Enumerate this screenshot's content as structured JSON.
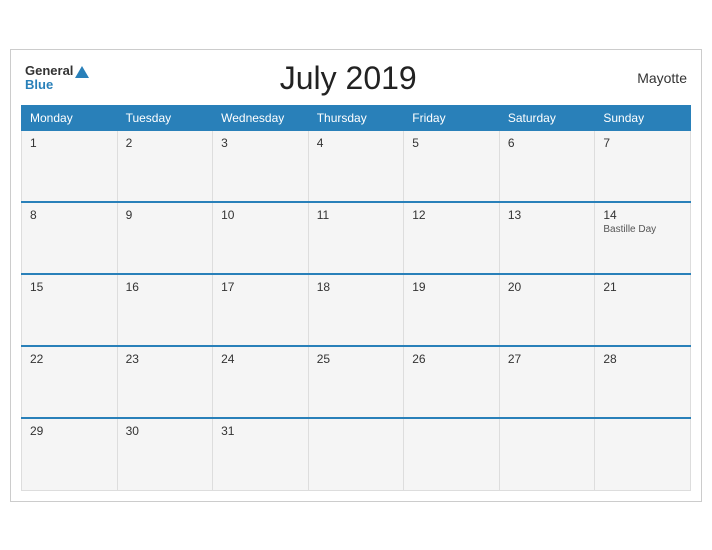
{
  "header": {
    "title": "July 2019",
    "region": "Mayotte",
    "logo_general": "General",
    "logo_blue": "Blue"
  },
  "days_of_week": [
    "Monday",
    "Tuesday",
    "Wednesday",
    "Thursday",
    "Friday",
    "Saturday",
    "Sunday"
  ],
  "weeks": [
    [
      {
        "day": "1",
        "event": ""
      },
      {
        "day": "2",
        "event": ""
      },
      {
        "day": "3",
        "event": ""
      },
      {
        "day": "4",
        "event": ""
      },
      {
        "day": "5",
        "event": ""
      },
      {
        "day": "6",
        "event": ""
      },
      {
        "day": "7",
        "event": ""
      }
    ],
    [
      {
        "day": "8",
        "event": ""
      },
      {
        "day": "9",
        "event": ""
      },
      {
        "day": "10",
        "event": ""
      },
      {
        "day": "11",
        "event": ""
      },
      {
        "day": "12",
        "event": ""
      },
      {
        "day": "13",
        "event": ""
      },
      {
        "day": "14",
        "event": "Bastille Day"
      }
    ],
    [
      {
        "day": "15",
        "event": ""
      },
      {
        "day": "16",
        "event": ""
      },
      {
        "day": "17",
        "event": ""
      },
      {
        "day": "18",
        "event": ""
      },
      {
        "day": "19",
        "event": ""
      },
      {
        "day": "20",
        "event": ""
      },
      {
        "day": "21",
        "event": ""
      }
    ],
    [
      {
        "day": "22",
        "event": ""
      },
      {
        "day": "23",
        "event": ""
      },
      {
        "day": "24",
        "event": ""
      },
      {
        "day": "25",
        "event": ""
      },
      {
        "day": "26",
        "event": ""
      },
      {
        "day": "27",
        "event": ""
      },
      {
        "day": "28",
        "event": ""
      }
    ],
    [
      {
        "day": "29",
        "event": ""
      },
      {
        "day": "30",
        "event": ""
      },
      {
        "day": "31",
        "event": ""
      },
      {
        "day": "",
        "event": ""
      },
      {
        "day": "",
        "event": ""
      },
      {
        "day": "",
        "event": ""
      },
      {
        "day": "",
        "event": ""
      }
    ]
  ],
  "colors": {
    "header_bg": "#2980b9",
    "blue_accent": "#2980b9"
  }
}
